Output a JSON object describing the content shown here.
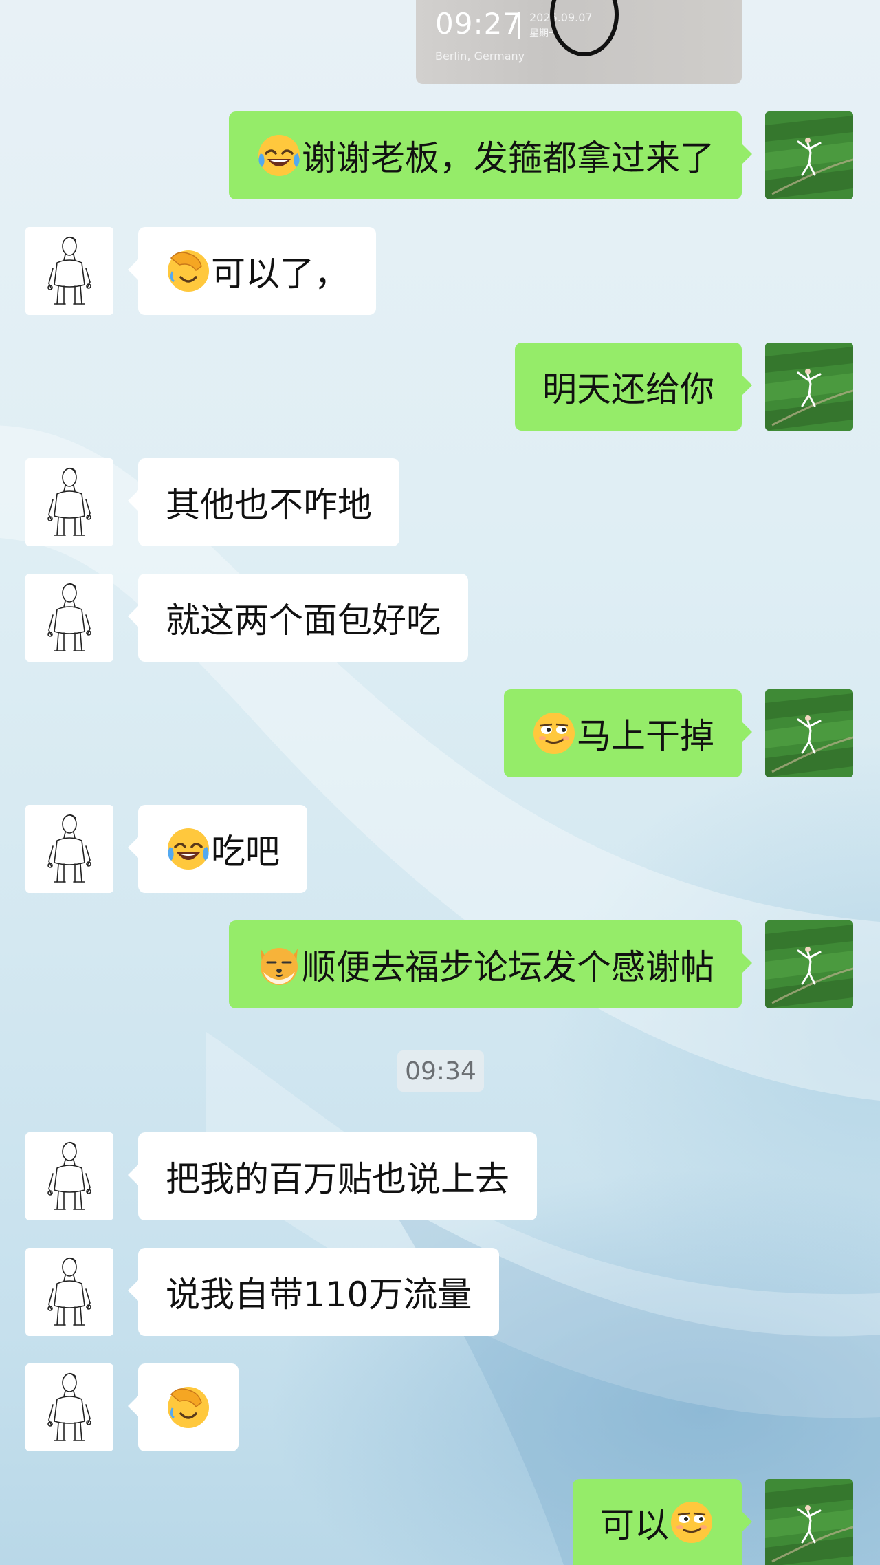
{
  "shared_image": {
    "clock_time": "09:27",
    "date": "2026.09.07",
    "weekday": "星期一",
    "location": "Berlin, Germany"
  },
  "timestamp": "09:34",
  "messages": [
    {
      "side": "right",
      "text": "谢谢老板，发箍都拿过来了",
      "emoji_before": "joy-tears"
    },
    {
      "side": "left",
      "text": "可以了，",
      "emoji_before": "facepalm"
    },
    {
      "side": "right",
      "text": "明天还给你"
    },
    {
      "side": "left",
      "text": "其他也不咋地"
    },
    {
      "side": "left",
      "text": "就这两个面包好吃"
    },
    {
      "side": "right",
      "text": "马上干掉",
      "emoji_before": "smirk"
    },
    {
      "side": "left",
      "text": "吃吧",
      "emoji_before": "joy-tears"
    },
    {
      "side": "right",
      "text": "顺便去福步论坛发个感谢帖",
      "emoji_before": "doge"
    },
    {
      "side": "left",
      "text": "把我的百万贴也说上去"
    },
    {
      "side": "left",
      "text": "说我自带110万流量"
    },
    {
      "side": "left",
      "text": "",
      "emoji_before": "facepalm"
    },
    {
      "side": "right",
      "text": "可以",
      "emoji_after": "smirk"
    }
  ],
  "colors": {
    "bubble_self": "#95ec69",
    "bubble_other": "#ffffff",
    "timestamp_text": "#6b6f73"
  }
}
